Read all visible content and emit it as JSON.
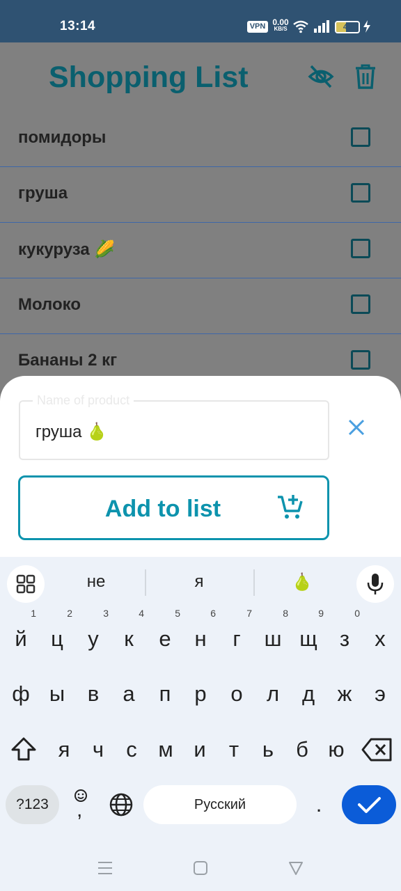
{
  "status_bar": {
    "time": "13:14",
    "vpn_label": "VPN",
    "net_speed_value": "0.00",
    "net_speed_unit": "KB/S",
    "battery_level": "45",
    "icons": [
      "wifi-icon",
      "signal-icon",
      "battery-icon",
      "charging-icon"
    ]
  },
  "app": {
    "title": "Shopping List",
    "header_icons": [
      "eye-off-icon",
      "trash-icon"
    ],
    "items": [
      {
        "label": "помидоры",
        "checked": false
      },
      {
        "label": "груша",
        "checked": false
      },
      {
        "label": "кукуруза 🌽",
        "checked": false
      },
      {
        "label": "Молоко",
        "checked": false
      },
      {
        "label": "Бананы 2 кг",
        "checked": false
      }
    ]
  },
  "sheet": {
    "field_label": "Name of product",
    "field_value": "груша 🍐",
    "add_button_label": "Add to list",
    "icons": [
      "close-icon",
      "add-cart-icon"
    ]
  },
  "keyboard": {
    "suggestions": [
      "не",
      "я",
      "🍐"
    ],
    "row1": [
      {
        "key": "й",
        "hint": "1"
      },
      {
        "key": "ц",
        "hint": "2"
      },
      {
        "key": "у",
        "hint": "3"
      },
      {
        "key": "к",
        "hint": "4"
      },
      {
        "key": "е",
        "hint": "5"
      },
      {
        "key": "н",
        "hint": "6"
      },
      {
        "key": "г",
        "hint": "7"
      },
      {
        "key": "ш",
        "hint": "8"
      },
      {
        "key": "щ",
        "hint": "9"
      },
      {
        "key": "з",
        "hint": "0"
      },
      {
        "key": "х",
        "hint": ""
      }
    ],
    "row2": [
      "ф",
      "ы",
      "в",
      "а",
      "п",
      "р",
      "о",
      "л",
      "д",
      "ж",
      "э"
    ],
    "row3": [
      "я",
      "ч",
      "с",
      "м",
      "и",
      "т",
      "ь",
      "б",
      "ю"
    ],
    "symbols_label": "?123",
    "comma_label": ",",
    "space_label": "Русский",
    "period_label": ".",
    "icons": [
      "grid-menu-icon",
      "mic-icon",
      "shift-icon",
      "backspace-icon",
      "emoji-icon",
      "globe-icon",
      "check-icon"
    ]
  },
  "nav_bar": {
    "icons": [
      "menu-icon",
      "home-icon",
      "back-icon"
    ]
  },
  "colors": {
    "status_bar": "#2f5272",
    "accent": "#0d93ad",
    "title": "#0a5f6e",
    "enter_key": "#0b5cd8"
  }
}
